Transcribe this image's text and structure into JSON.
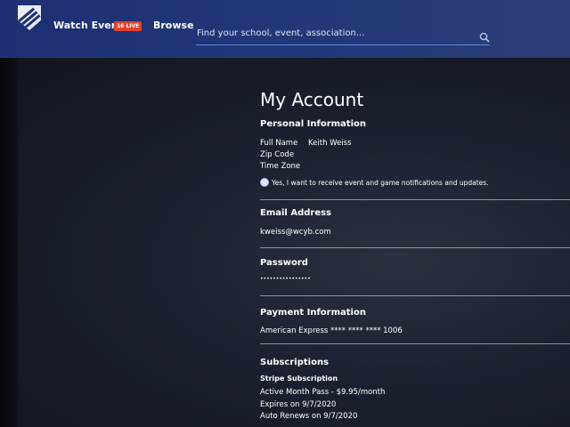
{
  "nav": {
    "watch_events": "Watch Events",
    "live_badge": "16 LIVE",
    "browse": "Browse",
    "search_placeholder": "Find your school, event, association..."
  },
  "account": {
    "title": "My Account",
    "personal": {
      "heading": "Personal Information",
      "full_name_label": "Full Name",
      "full_name_value": "Keith Weiss",
      "zip_label": "Zip Code",
      "timezone_label": "Time Zone",
      "notifications_label": "Yes, I want to receive event and game notifications and updates."
    },
    "email": {
      "heading": "Email Address",
      "value": "kweiss@wcyb.com"
    },
    "password": {
      "heading": "Password",
      "value": "••••••••••••••••"
    },
    "payment": {
      "heading": "Payment Information",
      "value": "American Express **** **** **** 1006"
    },
    "subscriptions": {
      "heading": "Subscriptions",
      "provider": "Stripe Subscription",
      "plan": "Active Month Pass - $9.95/month",
      "expires": "Expires on 9/7/2020",
      "renews": "Auto Renews on 9/7/2020"
    }
  }
}
